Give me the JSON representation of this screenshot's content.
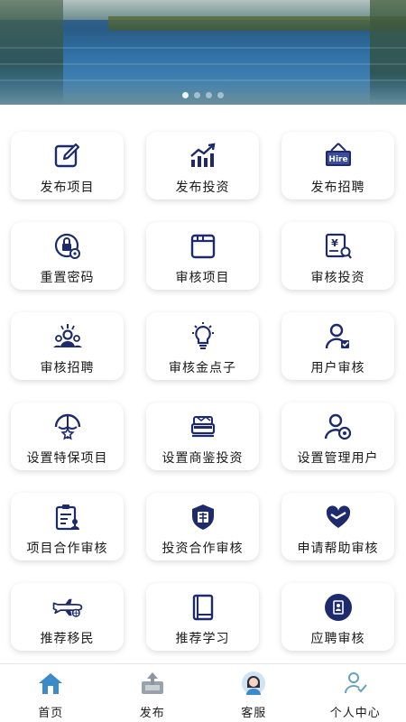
{
  "banner": {
    "slide_count": 4,
    "active_index": 0
  },
  "colors": {
    "icon_primary": "#1d2a6b",
    "accent_blue": "#3a8bc8",
    "card_bg": "#ffffff"
  },
  "grid": [
    {
      "label": "发布项目",
      "icon": "edit-icon"
    },
    {
      "label": "发布投资",
      "icon": "trend-chart-icon"
    },
    {
      "label": "发布招聘",
      "icon": "hire-sign-icon"
    },
    {
      "label": "重置密码",
      "icon": "lock-gear-icon"
    },
    {
      "label": "审核项目",
      "icon": "document-stack-icon"
    },
    {
      "label": "审核投资",
      "icon": "yen-search-icon"
    },
    {
      "label": "审核招聘",
      "icon": "team-icon"
    },
    {
      "label": "审核金点子",
      "icon": "lightbulb-icon"
    },
    {
      "label": "用户审核",
      "icon": "user-check-icon"
    },
    {
      "label": "设置特保项目",
      "icon": "star-shield-icon"
    },
    {
      "label": "设置商鉴投资",
      "icon": "cash-stack-icon"
    },
    {
      "label": "设置管理用户",
      "icon": "user-gear-icon"
    },
    {
      "label": "项目合作审核",
      "icon": "clipboard-user-icon"
    },
    {
      "label": "投资合作审核",
      "icon": "shield-seal-icon"
    },
    {
      "label": "申请帮助审核",
      "icon": "heart-hand-icon"
    },
    {
      "label": "推荐移民",
      "icon": "airplane-icon"
    },
    {
      "label": "推荐学习",
      "icon": "book-icon"
    },
    {
      "label": "应聘审核",
      "icon": "resume-badge-icon"
    }
  ],
  "nav": [
    {
      "label": "首页",
      "icon": "home-icon"
    },
    {
      "label": "发布",
      "icon": "upload-tray-icon"
    },
    {
      "label": "客服",
      "icon": "support-agent-icon"
    },
    {
      "label": "个人中心",
      "icon": "profile-check-icon"
    }
  ]
}
